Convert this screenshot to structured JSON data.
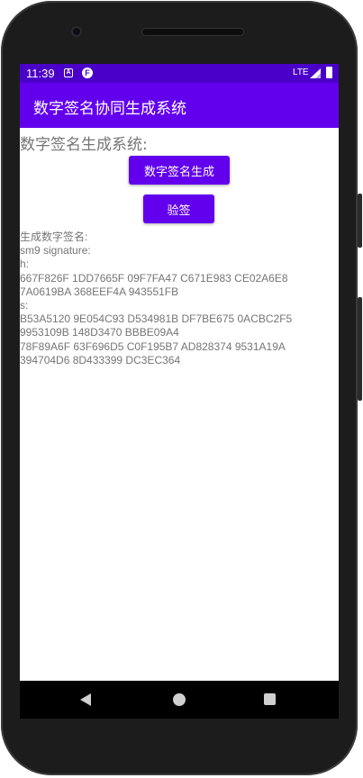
{
  "status_bar": {
    "time": "11:39",
    "icon_a": "A",
    "icon_f": "F",
    "network": "LTE",
    "signal_icon": "signal-icon",
    "battery_icon": "battery-icon"
  },
  "app_bar": {
    "title": "数字签名协同生成系统"
  },
  "content": {
    "heading": "数字签名生成系统:",
    "generate_button_label": "数字签名生成",
    "verify_button_label": "验签",
    "output_lines": [
      "生成数字签名:",
      "sm9 signature:",
      "h:",
      "667F826F 1DD7665F 09F7FA47 C671E983 CE02A6E8",
      "7A0619BA 368EEF4A 943551FB",
      "s:",
      "B53A5120 9E054C93 D534981B DF7BE675 0ACBC2F5",
      "9953109B 148D3470 BBBE09A4",
      "78F89A6F 63F696D5 C0F195B7 AD828374 9531A19A",
      "394704D6 8D433399 DC3EC364"
    ]
  },
  "navigation": {
    "back_icon": "back-triangle-icon",
    "home_icon": "home-circle-icon",
    "recents_icon": "recents-square-icon"
  },
  "colors": {
    "primary": "#6200ee",
    "primary_dark": "#4b00c9",
    "text_secondary": "#757575"
  }
}
